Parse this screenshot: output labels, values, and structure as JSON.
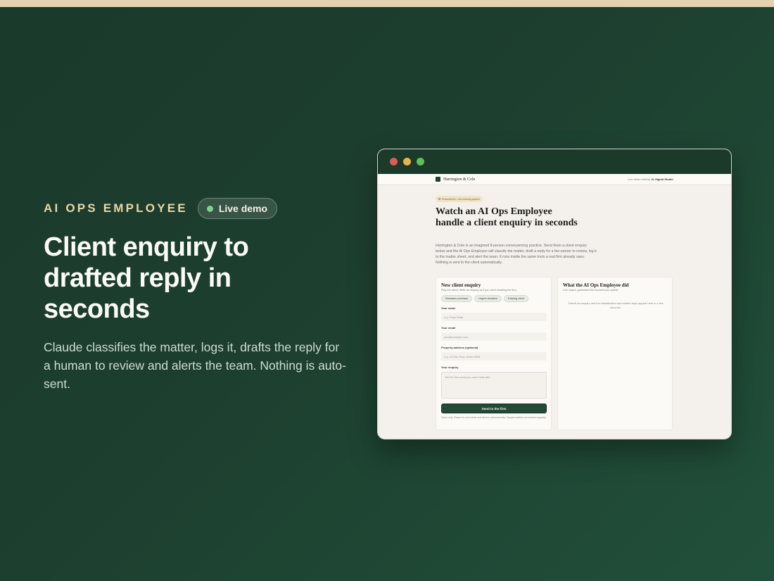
{
  "hero": {
    "eyebrow": "AI OPS EMPLOYEE",
    "badge": "Live demo",
    "title": "Client enquiry to drafted reply in seconds",
    "subtitle": "Claude classifies the matter, logs it, drafts the reply for a human to review and alerts the team. Nothing is auto-sent."
  },
  "browser": {
    "site": {
      "brand": "Harrington & Cole",
      "header_right_prefix": "Live demo built by",
      "header_right_strong": "JL Signal Studio",
      "notice": "Fictional firm, real working system",
      "title": "Watch an AI Ops Employee handle a client enquiry in seconds",
      "intro": "Harrington & Cole is an imagined 8-person conveyancing practice. Send them a client enquiry below and the AI Ops Employee will classify the matter, draft a reply for a fee-earner to review, log it to the matter sheet, and alert the team. It runs inside the same tools a real firm already uses. Nothing is sent to the client automatically.",
      "form": {
        "title": "New client enquiry",
        "subtitle": "Play the client. Write an enquiry as if you were emailing the firm.",
        "chips": [
          "Standard purchase",
          "Urgent deadline",
          "Existing client"
        ],
        "name_label": "Your name",
        "name_placeholder": "e.g. Priya Shah",
        "email_label": "Your email",
        "email_placeholder": "you@example.com",
        "address_label": "Property address (optional)",
        "address_placeholder": "e.g. 14 Elm Row, Bristol BS6",
        "enquiry_label": "Your enquiry",
        "enquiry_placeholder": "Tell the firm what you need help with.",
        "submit": "Send to the firm",
        "note": "Demo only. Please do not include real client or personal data. Sample matters are cleared regularly."
      },
      "result": {
        "title": "What the AI Ops Employee did",
        "subtitle": "Live output, generated the moment you submit.",
        "empty": "Submit an enquiry and the classification and drafted reply appear here in a few seconds."
      }
    }
  },
  "colors": {
    "background": "#1d3f2f",
    "accent": "#e9d7a4",
    "button": "#244a36",
    "live_dot": "#7fd18f"
  }
}
